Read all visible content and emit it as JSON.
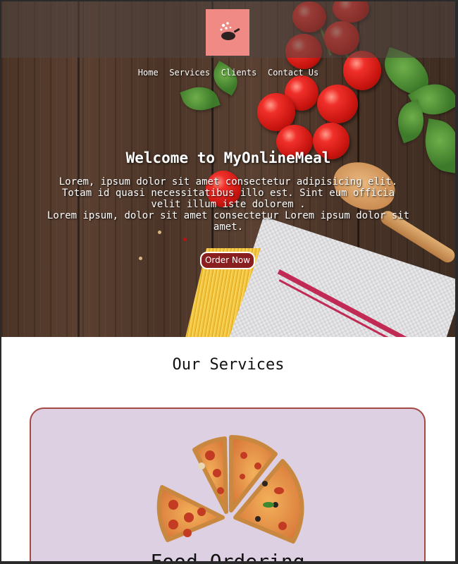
{
  "logo": {
    "icon": "cooking-pan-icon"
  },
  "nav": {
    "items": [
      {
        "label": "Home"
      },
      {
        "label": "Services"
      },
      {
        "label": "Clients"
      },
      {
        "label": "Contact Us"
      }
    ]
  },
  "hero": {
    "title": "Welcome to MyOnlineMeal",
    "paragraph1": "Lorem, ipsum dolor sit amet consectetur adipisicing elit. Totam id quasi necessitatibus illo est. Sint eum officia velit illum iste dolorem .",
    "paragraph2": "Lorem ipsum, dolor sit amet consectetur Lorem ipsum dolor sit amet.",
    "button_label": "Order Now"
  },
  "services": {
    "heading": "Our Services",
    "cards": [
      {
        "title": "Food Ordering",
        "icon": "pizza-slices-image"
      }
    ]
  },
  "colors": {
    "logo_bg": "#f08a84",
    "button_bg": "#8a1f20",
    "card_bg": "#ddd0e2",
    "card_border": "#a44a44"
  }
}
